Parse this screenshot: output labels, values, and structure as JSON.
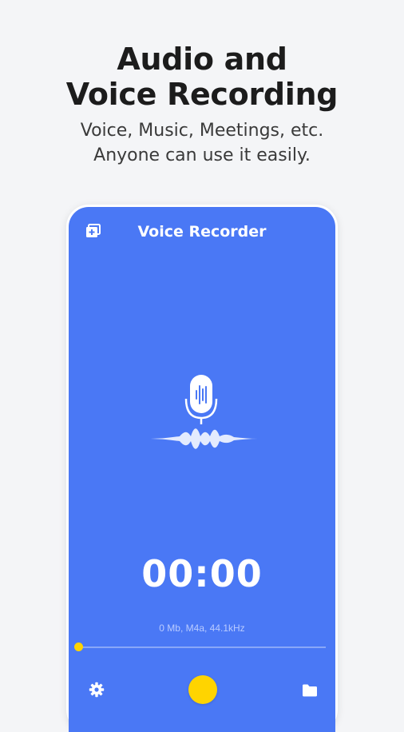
{
  "promo": {
    "headline_line1": "Audio and",
    "headline_line2": "Voice Recording",
    "sub_line1": "Voice, Music, Meetings, etc.",
    "sub_line2": "Anyone can use it easily."
  },
  "app": {
    "title": "Voice Recorder",
    "timer": "00:00",
    "file_info": "0 Mb, M4a, 44.1kHz",
    "progress_fraction": 0
  },
  "icons": {
    "top_left": "add-folder-icon",
    "center": "microphone-icon",
    "waveform": "waveform-icon",
    "bottom_left": "settings-icon",
    "bottom_center": "record-button",
    "bottom_right": "folder-icon"
  },
  "colors": {
    "background": "#f4f5f7",
    "screen": "#4a78f5",
    "accent": "#ffd400",
    "text_dark": "#1c1c1c",
    "text_white": "#ffffff"
  }
}
